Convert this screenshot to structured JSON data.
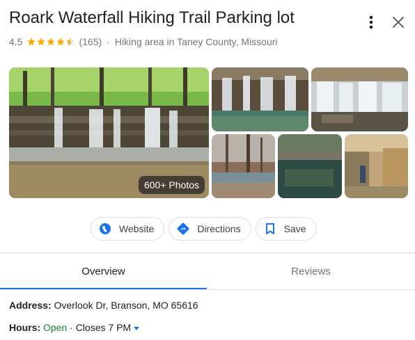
{
  "place": {
    "name": "Roark Waterfall Hiking Trail Parking lot",
    "rating": "4.5",
    "stars": 4.5,
    "review_count": "(165)",
    "separator": "·",
    "category": "Hiking area in Taney County, Missouri"
  },
  "icons": {
    "more": "more-vert-icon",
    "close": "close-icon",
    "star": "star-icon",
    "website": "globe-icon",
    "directions": "directions-icon",
    "save": "bookmark-icon"
  },
  "photos": {
    "badge": "600+ Photos"
  },
  "actions": {
    "website": "Website",
    "directions": "Directions",
    "save": "Save"
  },
  "tabs": {
    "overview": "Overview",
    "reviews": "Reviews"
  },
  "info": {
    "address_label": "Address:",
    "address_value": "Overlook Dr, Branson, MO 65616",
    "hours_label": "Hours:",
    "hours_status": "Open",
    "hours_detail": " · Closes 7 PM"
  },
  "colors": {
    "star": "#f9ab00",
    "accent": "#1a73e8",
    "open": "#188038"
  }
}
